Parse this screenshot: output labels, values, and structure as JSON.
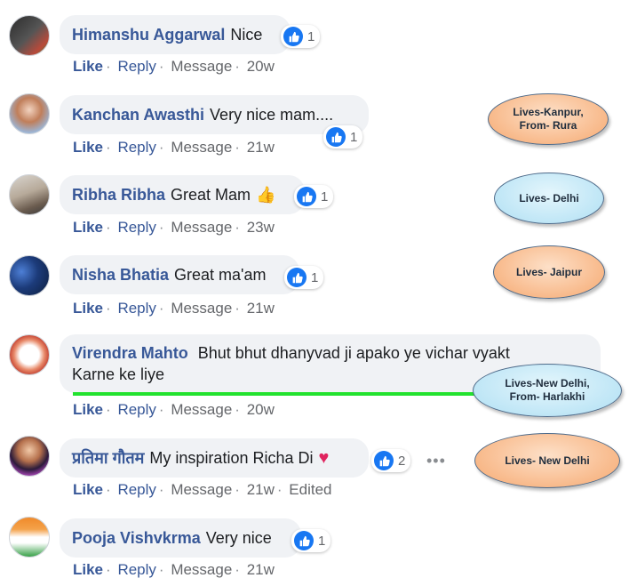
{
  "comments": [
    {
      "name": "Himanshu Aggarwal",
      "text": "Nice",
      "reactions": "1",
      "actions": {
        "like": "Like",
        "reply": "Reply",
        "message": "Message",
        "time": "20w"
      }
    },
    {
      "name": "Kanchan Awasthi",
      "text": "Very nice mam....",
      "reactions": "1",
      "actions": {
        "like": "Like",
        "reply": "Reply",
        "message": "Message",
        "time": "21w"
      }
    },
    {
      "name": "Ribha Ribha",
      "text": "Great Mam",
      "emoji": "👍",
      "reactions": "1",
      "actions": {
        "like": "Like",
        "reply": "Reply",
        "message": "Message",
        "time": "23w"
      }
    },
    {
      "name": "Nisha Bhatia",
      "text": "Great ma'am",
      "reactions": "1",
      "actions": {
        "like": "Like",
        "reply": "Reply",
        "message": "Message",
        "time": "21w"
      }
    },
    {
      "name": "Virendra Mahto",
      "text_line1": "Bhut bhut dhanyvad ji apako ye vichar vyakt",
      "text_line2": "Karne ke liye",
      "actions": {
        "like": "Like",
        "reply": "Reply",
        "message": "Message",
        "time": "20w"
      }
    },
    {
      "name": "प्रतिमा गौतम",
      "text": "My inspiration Richa Di",
      "emoji": "♥",
      "reactions": "2",
      "more": "•••",
      "actions": {
        "like": "Like",
        "reply": "Reply",
        "message": "Message",
        "time": "21w",
        "edited": "Edited"
      }
    },
    {
      "name": "Pooja Vishvkrma",
      "text": "Very nice",
      "reactions": "1",
      "actions": {
        "like": "Like",
        "reply": "Reply",
        "message": "Message",
        "time": "21w"
      }
    }
  ],
  "annotations": [
    {
      "line1": "Lives-Kanpur,",
      "line2": "From- Rura"
    },
    {
      "line1": "Lives- Delhi"
    },
    {
      "line1": "Lives- Jaipur"
    },
    {
      "line1": "Lives-New Delhi,",
      "line2": "From- Harlakhi"
    },
    {
      "line1": "Lives- New Delhi"
    }
  ],
  "colors": {
    "name": "#385898",
    "like_blue": "#1877f2",
    "bubble": "#f0f2f5",
    "highlight": "#22e22e",
    "heart": "#e0245e"
  }
}
